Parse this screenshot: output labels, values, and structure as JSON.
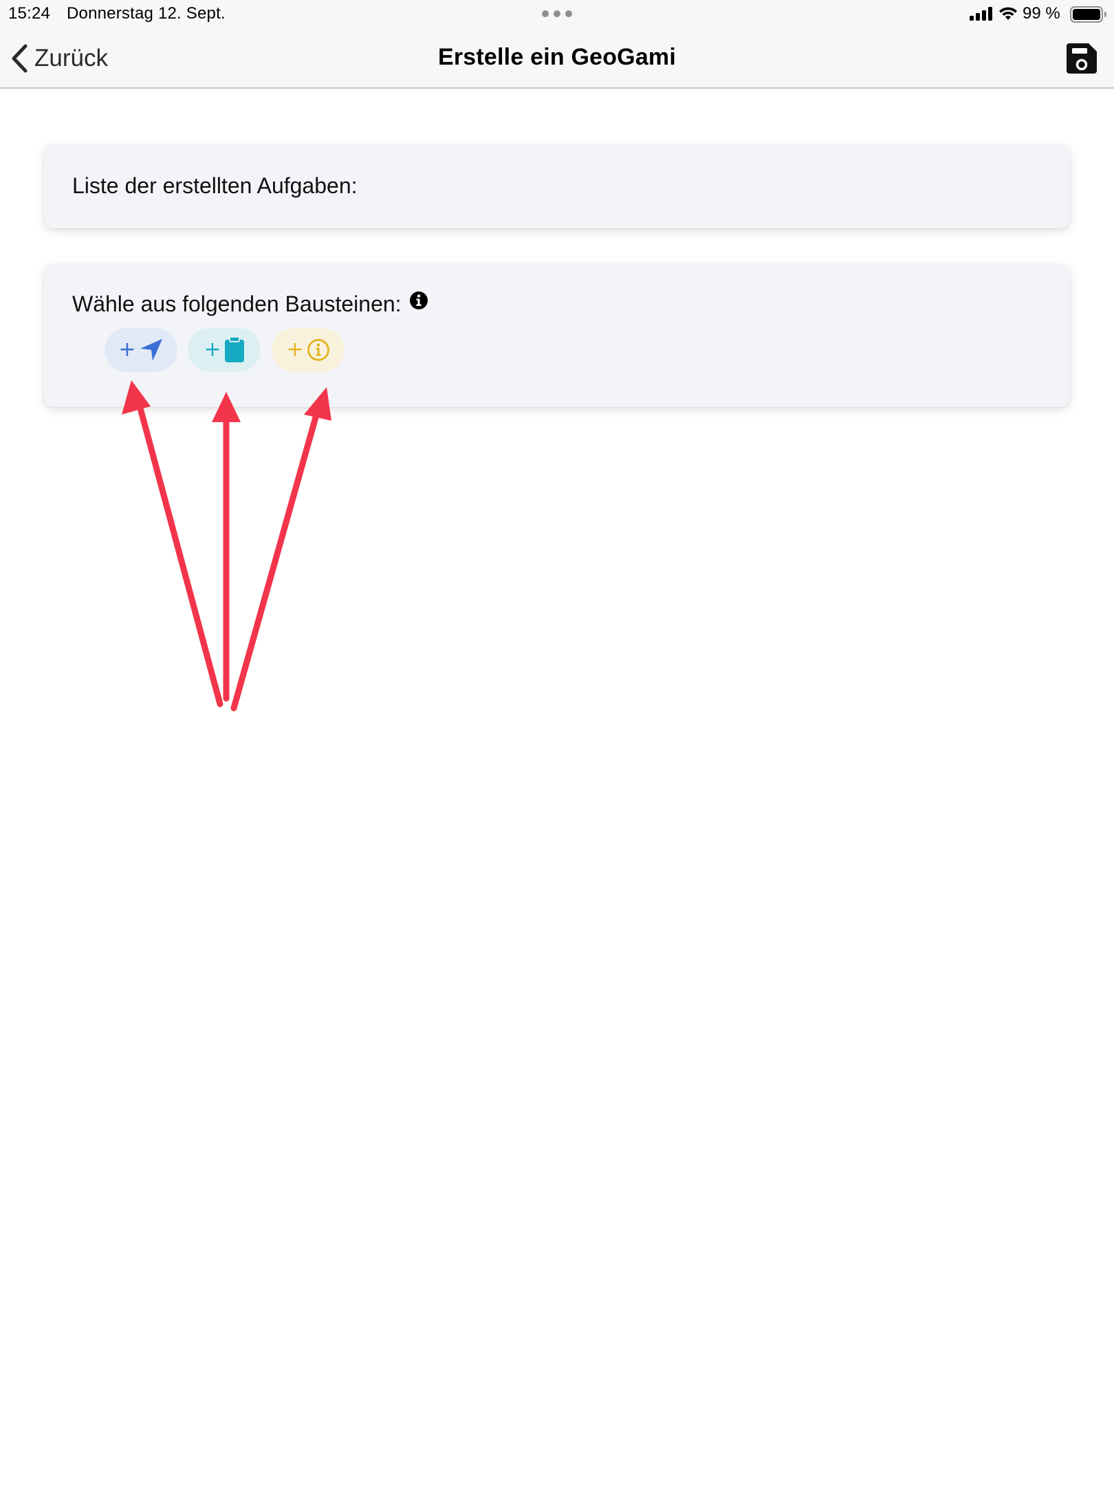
{
  "status_bar": {
    "time": "15:24",
    "date": "Donnerstag 12. Sept.",
    "battery_percent": "99 %",
    "icons": [
      "cellular-signal-icon",
      "wifi-icon",
      "battery-icon"
    ]
  },
  "nav": {
    "back_label": "Zurück",
    "title": "Erstelle ein GeoGami",
    "save_icon": "save-disk-icon"
  },
  "tasks_card": {
    "heading": "Liste der erstellten Aufgaben:"
  },
  "blocks_card": {
    "heading": "Wähle aus folgenden Bausteinen:",
    "info_icon": "info-circle-icon",
    "chips": [
      {
        "plus": "+",
        "icon": "navigation-arrow-icon",
        "color": "#3c6fd6",
        "background": "#e1e9f7"
      },
      {
        "plus": "+",
        "icon": "clipboard-icon",
        "color": "#16a9c2",
        "background": "#dcf0f4"
      },
      {
        "plus": "+",
        "icon": "info-icon",
        "color": "#e3b320",
        "background": "#f8f1dc"
      }
    ]
  },
  "annotation": {
    "arrow_color": "#f2354a",
    "arrow_count": 3
  },
  "colors": {
    "bar_background": "#f7f7f8",
    "card_background": "#f3f4f8",
    "page_background": "#ffffff"
  }
}
